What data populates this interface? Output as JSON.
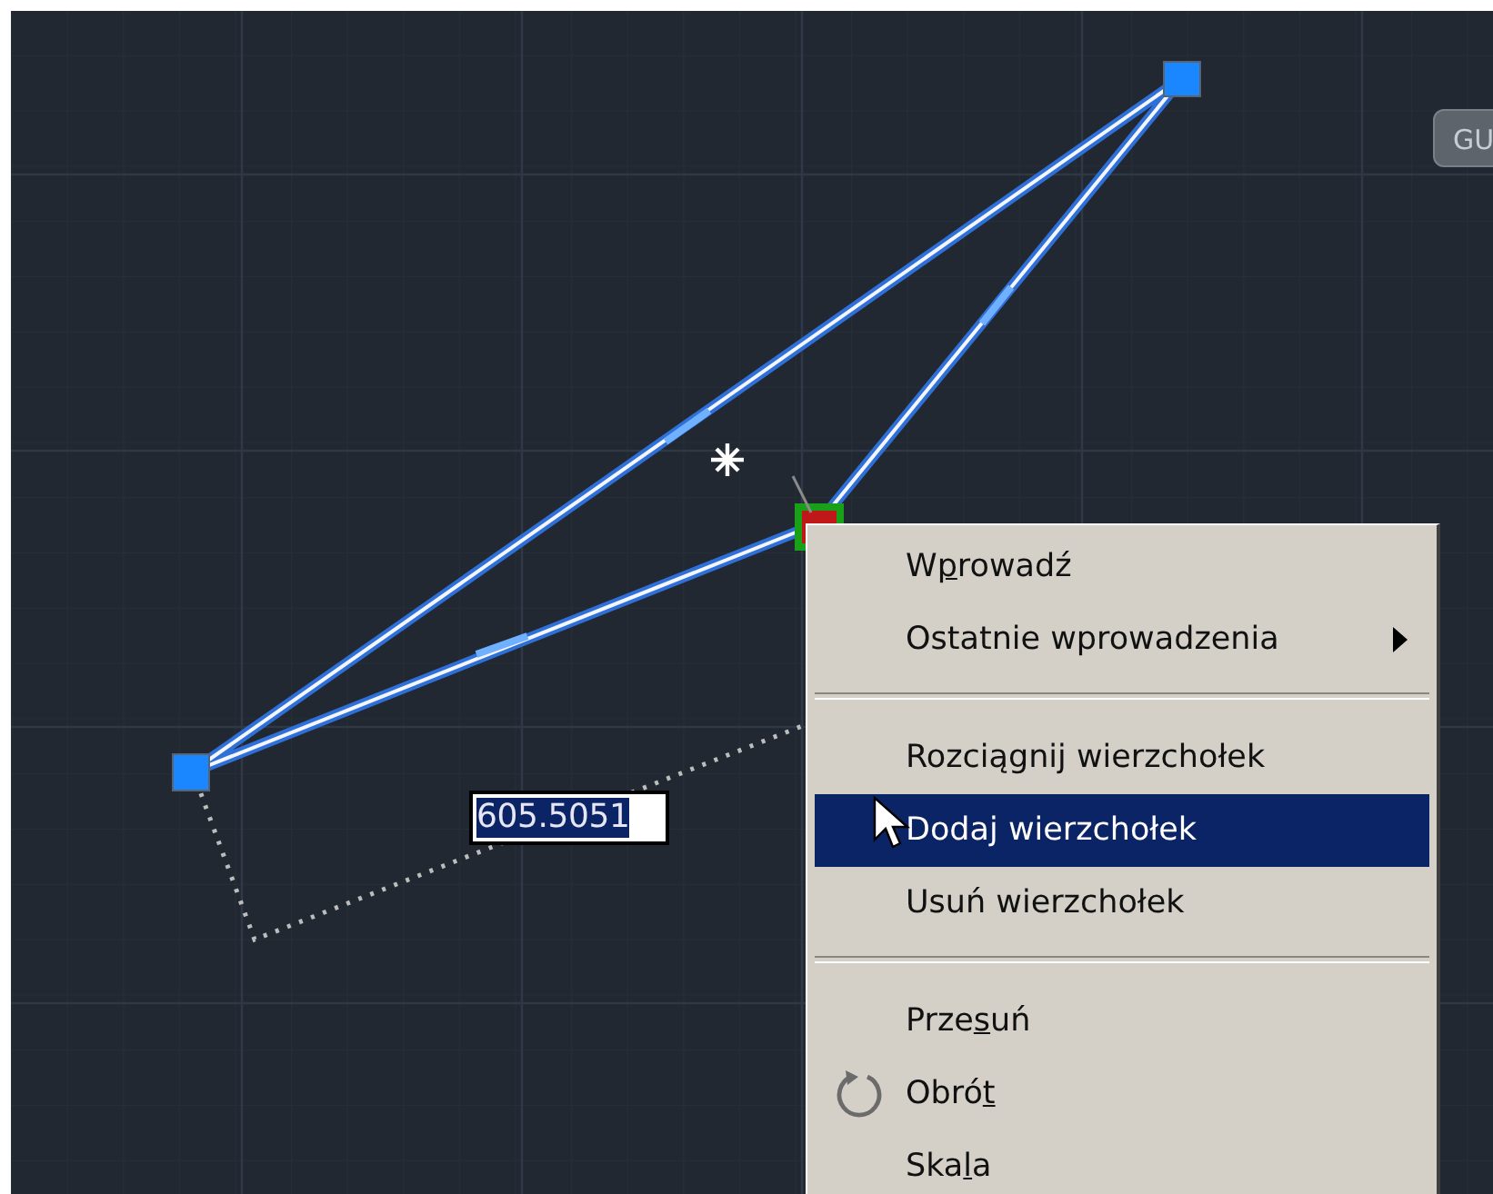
{
  "badge": {
    "label": "GU"
  },
  "dimension_input": {
    "value": "605.5051",
    "value_selected": true
  },
  "context_menu": {
    "items": [
      {
        "kind": "item",
        "before": "W",
        "mnemonic": "p",
        "after": "rowadź",
        "selected": false,
        "submenu": false
      },
      {
        "kind": "item",
        "before": "Ostatnie wprowadzenia",
        "selected": false,
        "submenu": true
      },
      {
        "kind": "separator"
      },
      {
        "kind": "item",
        "before": "Rozciągnij wierzchołek",
        "selected": false,
        "submenu": false
      },
      {
        "kind": "item",
        "before": "Dodaj wierzchołek",
        "selected": true,
        "submenu": false
      },
      {
        "kind": "item",
        "before": "Usuń wierzchołek",
        "selected": false,
        "submenu": false
      },
      {
        "kind": "separator"
      },
      {
        "kind": "item",
        "before": "Prze",
        "mnemonic": "s",
        "after": "uń",
        "selected": false,
        "submenu": false
      },
      {
        "kind": "rotate",
        "before": "Obró",
        "mnemonic": "t",
        "selected": false,
        "submenu": false
      },
      {
        "kind": "item",
        "before": "Ska",
        "mnemonic": "l",
        "after": "a",
        "selected": false,
        "submenu": false
      }
    ]
  }
}
